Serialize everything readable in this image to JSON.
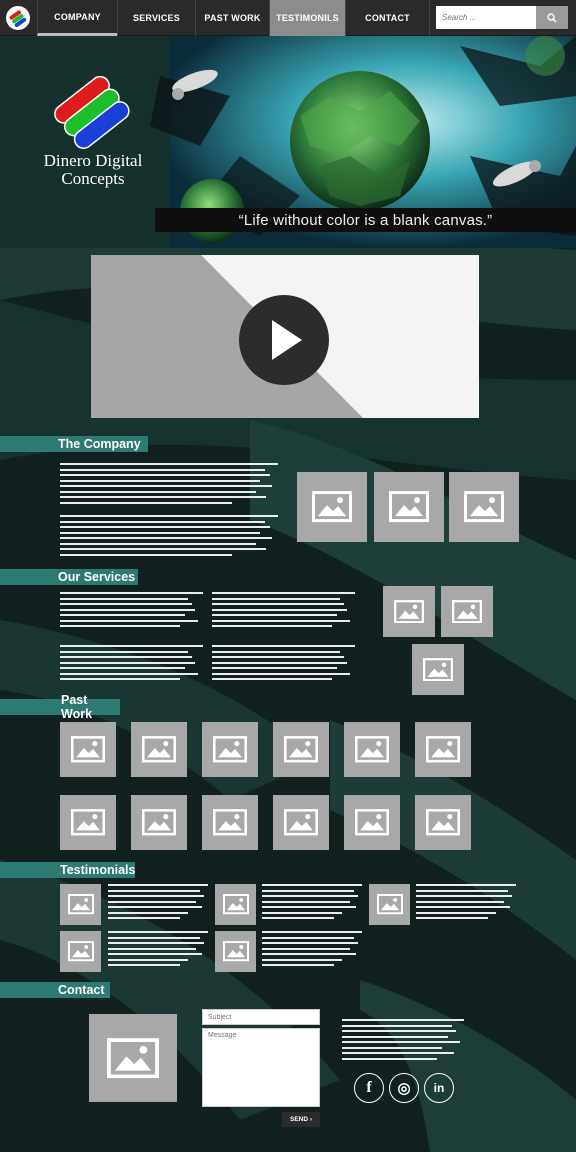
{
  "nav": {
    "items": [
      {
        "label": "COMPANY"
      },
      {
        "label": "SERVICES"
      },
      {
        "label": "PAST WORK"
      },
      {
        "label": "TESTIMONILS"
      },
      {
        "label": "CONTACT"
      }
    ],
    "search_placeholder": "Search ...",
    "logo_icon": "rgb-circle-logo-icon"
  },
  "hero": {
    "brand_line1": "Dinero Digital",
    "brand_line2": "Concepts",
    "quote": "“Life without color is a blank canvas.”",
    "logo_colors": [
      "#e01b1b",
      "#1bbf2a",
      "#1a3fd9"
    ]
  },
  "video": {
    "icon": "play-icon"
  },
  "sections": {
    "company": "The Company",
    "services": "Our Services",
    "past_work": "Past Work",
    "testimonials": "Testimonials",
    "contact": "Contact"
  },
  "contact": {
    "subject_placeholder": "Subject",
    "message_placeholder": "Message",
    "send_label": "SEND ›",
    "social": [
      "facebook-icon",
      "instagram-icon",
      "linkedin-icon"
    ],
    "social_glyphs": [
      "f",
      "◎",
      "in"
    ]
  },
  "colors": {
    "background": "#12211f",
    "accent": "#2d7a72",
    "nav": "#2a2a2a",
    "placeholder": "#a8a8a8"
  }
}
